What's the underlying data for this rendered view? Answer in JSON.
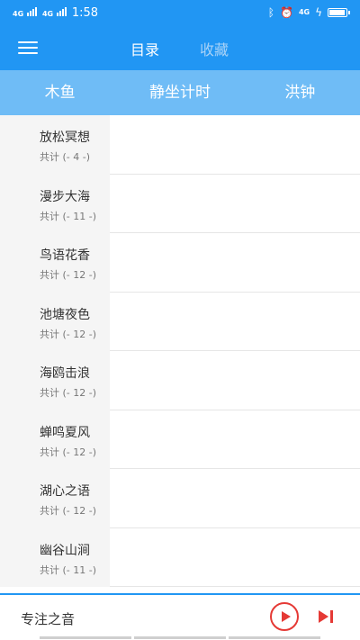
{
  "status_bar": {
    "signal1": "4G",
    "signal2": "4G",
    "time": "1:58",
    "net_type": "4G",
    "bluetooth_icon": "bluetooth-icon",
    "alarm_icon": "alarm-icon",
    "battery_level": 0.85
  },
  "header": {
    "tabs": [
      {
        "label": "目录",
        "active": true
      },
      {
        "label": "收藏",
        "active": false
      }
    ]
  },
  "categories": [
    {
      "label": "木鱼"
    },
    {
      "label": "静坐计时"
    },
    {
      "label": "洪钟"
    }
  ],
  "playlist": [
    {
      "title": "放松冥想",
      "count": "共计 (- 4 -)"
    },
    {
      "title": "漫步大海",
      "count": "共计 (- 11 -)"
    },
    {
      "title": "鸟语花香",
      "count": "共计 (- 12 -)"
    },
    {
      "title": "池塘夜色",
      "count": "共计 (- 12 -)"
    },
    {
      "title": "海鸥击浪",
      "count": "共计 (- 12 -)"
    },
    {
      "title": "蝉鸣夏风",
      "count": "共计 (- 12 -)"
    },
    {
      "title": "湖心之语",
      "count": "共计 (- 12 -)"
    },
    {
      "title": "幽谷山涧",
      "count": "共计 (- 11 -)"
    }
  ],
  "player": {
    "title": "专注之音"
  },
  "colors": {
    "primary": "#2196f3",
    "subtab_bg": "#6fbcf6",
    "accent_red": "#e53935"
  }
}
